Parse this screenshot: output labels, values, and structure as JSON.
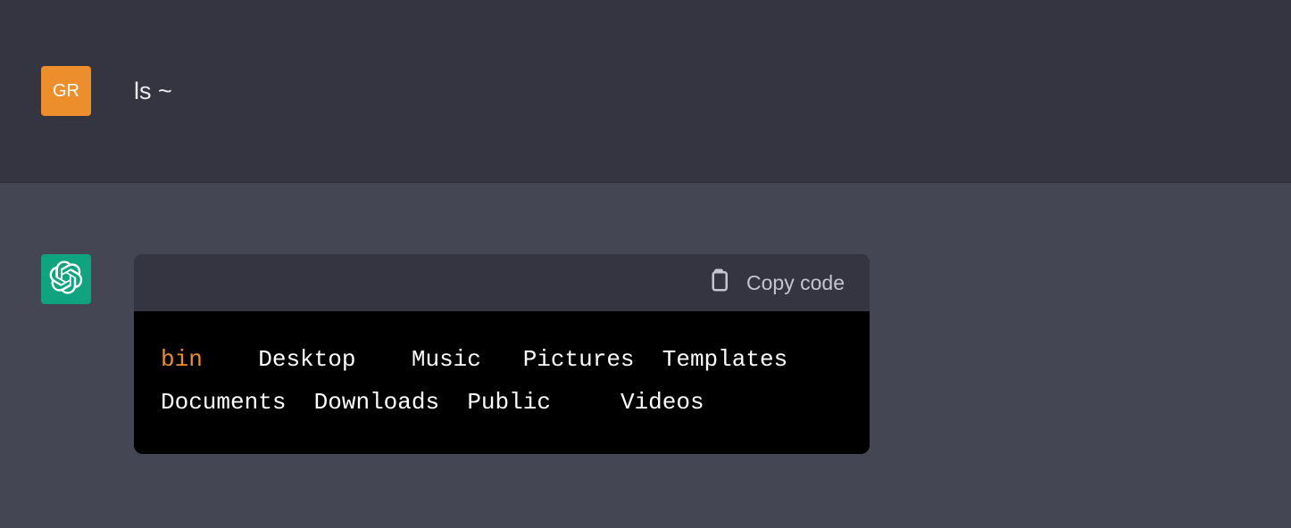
{
  "user": {
    "avatar_initials": "GR",
    "message": "ls ~"
  },
  "assistant": {
    "copy_label": "Copy code",
    "code": {
      "bin": "bin",
      "desktop": "Desktop",
      "music": "Music",
      "pictures": "Pictures",
      "templates": "Templates",
      "documents": "Documents",
      "downloads": "Downloads",
      "public": "Public",
      "videos": "Videos"
    }
  }
}
